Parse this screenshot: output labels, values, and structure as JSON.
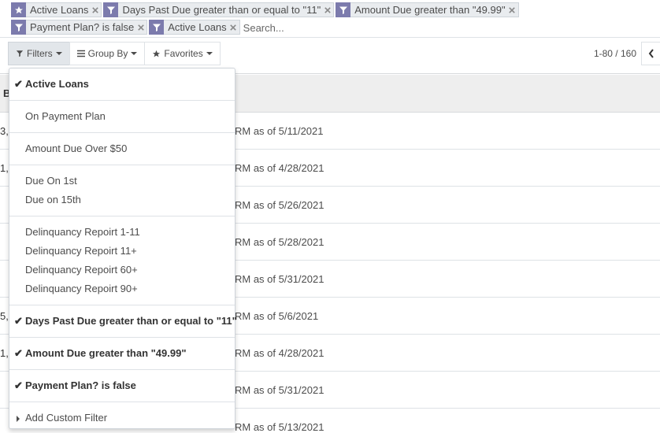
{
  "facets": [
    {
      "icon": "star-icon",
      "label": "Active Loans"
    },
    {
      "icon": "filter-icon",
      "label": "Days Past Due greater than or equal to \"11\""
    },
    {
      "icon": "filter-icon",
      "label": "Amount Due greater than \"49.99\""
    },
    {
      "icon": "filter-icon",
      "label": "Payment Plan? is false"
    },
    {
      "icon": "filter-icon",
      "label": "Active Loans"
    }
  ],
  "search": {
    "placeholder": "Search..."
  },
  "toolbar": {
    "filters_label": "Filters",
    "groupby_label": "Group By",
    "favorites_label": "Favorites"
  },
  "pager": {
    "value": "1-80 / 160"
  },
  "list": {
    "header_first_char": "B",
    "rows": [
      {
        "lead": "3,",
        "text": "RM as of 5/11/2021"
      },
      {
        "lead": "1,",
        "text": "RM as of 4/28/2021"
      },
      {
        "lead": "",
        "text": "RM as of 5/26/2021"
      },
      {
        "lead": "",
        "text": "RM as of 5/28/2021"
      },
      {
        "lead": "",
        "text": "RM as of 5/31/2021"
      },
      {
        "lead": "5,",
        "text": "RM as of 5/6/2021"
      },
      {
        "lead": "1,",
        "text": "RM as of 4/28/2021"
      },
      {
        "lead": "",
        "text": "RM as of 5/31/2021"
      },
      {
        "lead": "",
        "text": "RM as of 5/13/2021"
      }
    ]
  },
  "dropdown": {
    "check_glyph": "✔",
    "groups": [
      {
        "items": [
          {
            "label": "Active Loans",
            "selected": true
          }
        ]
      },
      {
        "items": [
          {
            "label": "On Payment Plan",
            "selected": false
          }
        ]
      },
      {
        "items": [
          {
            "label": "Amount Due Over $50",
            "selected": false
          }
        ]
      },
      {
        "items": [
          {
            "label": "Due On 1st",
            "selected": false
          },
          {
            "label": "Due on 15th",
            "selected": false
          }
        ]
      },
      {
        "items": [
          {
            "label": "Delinquancy Repoirt 1-11",
            "selected": false
          },
          {
            "label": "Delinquancy Repoirt 11+",
            "selected": false
          },
          {
            "label": "Delinquancy Repoirt 60+",
            "selected": false
          },
          {
            "label": "Delinquancy Repoirt 90+",
            "selected": false
          }
        ]
      },
      {
        "items": [
          {
            "label": "Days Past Due greater than or equal to \"11\"",
            "selected": true
          }
        ]
      },
      {
        "items": [
          {
            "label": "Amount Due greater than \"49.99\"",
            "selected": true
          }
        ]
      },
      {
        "items": [
          {
            "label": "Payment Plan? is false",
            "selected": true
          }
        ]
      }
    ],
    "add_custom_filter": "Add Custom Filter"
  },
  "colors": {
    "facet_icon_bg": "#7c7bad",
    "header_bg": "#eeeeee"
  }
}
